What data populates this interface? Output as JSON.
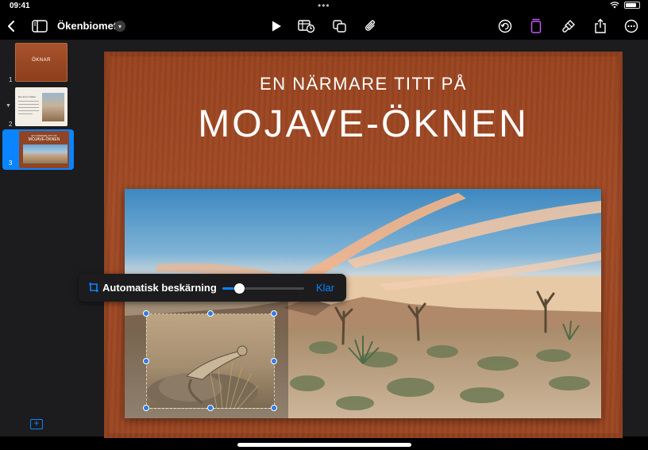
{
  "status_bar": {
    "time": "09:41",
    "dots": "•••"
  },
  "toolbar": {
    "document_title": "Ökenbiomet",
    "icons": [
      "back-icon",
      "sidebar-icon",
      "play-icon",
      "table-chart-icon",
      "shapes-icon",
      "attachment-icon",
      "undo-icon",
      "format-icon",
      "brush-icon",
      "share-icon",
      "more-icon"
    ]
  },
  "sidebar": {
    "slides": [
      {
        "number": "1",
        "title": "ÖKNAR"
      },
      {
        "number": "2",
        "title": "Ner till en Öcken"
      },
      {
        "number": "3",
        "subtitle": "EN NÄRMARE TITT PÅ",
        "title": "MOJAVE-ÖKNEN"
      }
    ],
    "selected": "3",
    "add_label": "+"
  },
  "slide": {
    "subtitle": "EN NÄRMARE TITT PÅ",
    "title": "MOJAVE-ÖKNEN"
  },
  "crop_popover": {
    "label": "Automatisk beskärning",
    "slider_fraction": 0.2,
    "done_label": "Klar"
  },
  "colors": {
    "accent": "#0a84ff",
    "slide_background": "#9f4924",
    "toolbar_format_active": "#bf5af2"
  }
}
